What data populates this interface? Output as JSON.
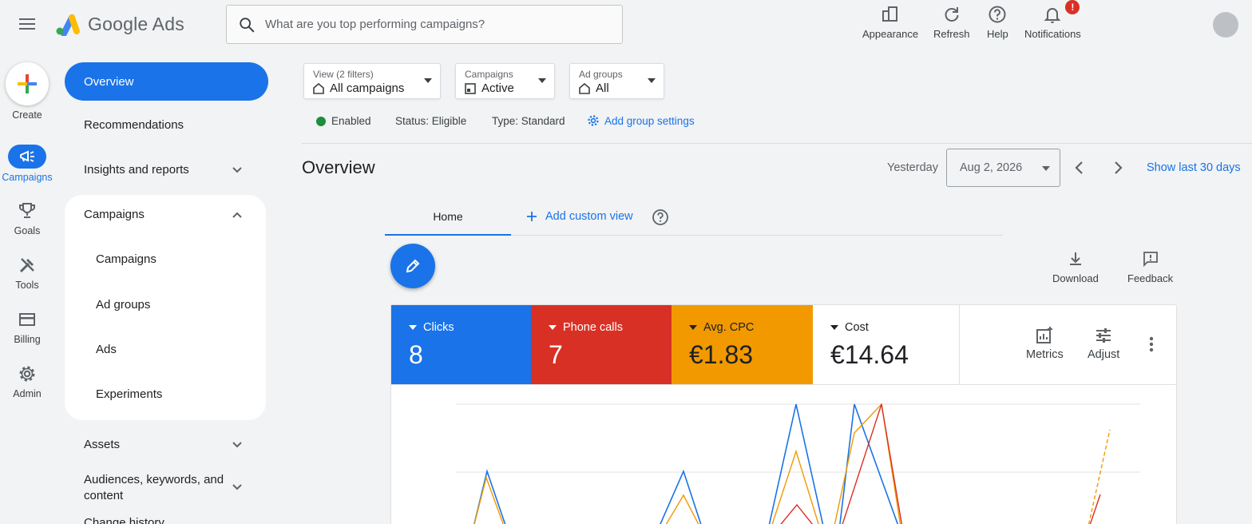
{
  "app": {
    "name": "Google Ads"
  },
  "search": {
    "placeholder": "What are you top performing campaigns?"
  },
  "top_actions": [
    {
      "label": "Appearance",
      "icon": "appearance-icon"
    },
    {
      "label": "Refresh",
      "icon": "refresh-icon"
    },
    {
      "label": "Help",
      "icon": "help-icon"
    },
    {
      "label": "Notifications",
      "icon": "notifications-icon",
      "badge": "!"
    }
  ],
  "rail": [
    {
      "label": "Create",
      "icon": "plus-icon"
    },
    {
      "label": "Campaigns",
      "icon": "campaigns-icon",
      "active": true
    },
    {
      "label": "Goals",
      "icon": "trophy-icon"
    },
    {
      "label": "Tools",
      "icon": "tools-icon"
    },
    {
      "label": "Billing",
      "icon": "card-icon"
    },
    {
      "label": "Admin",
      "icon": "gear-icon"
    }
  ],
  "nav": {
    "overview": "Overview",
    "recommendations": "Recommendations",
    "insights": "Insights and reports",
    "campaigns_group": "Campaigns",
    "sub": [
      "Campaigns",
      "Ad groups",
      "Ads",
      "Experiments"
    ],
    "assets": "Assets",
    "audiences": "Audiences, keywords, and content",
    "change_history": "Change history"
  },
  "filters": [
    {
      "label": "View (2 filters)",
      "value": "All campaigns"
    },
    {
      "label": "Campaigns",
      "value": "Active"
    },
    {
      "label": "Ad groups",
      "value": "All"
    }
  ],
  "status": {
    "enabled": "Enabled",
    "status": "Status: Eligible",
    "type": "Type: Standard",
    "settings_link": "Add group settings"
  },
  "overview": {
    "title": "Overview",
    "yesterday": "Yesterday",
    "date": "Aug 2, 2026",
    "show_last": "Show last 30 days"
  },
  "tabs": {
    "home": "Home",
    "add_custom": "Add custom view"
  },
  "actions": {
    "download": "Download",
    "feedback": "Feedback"
  },
  "metrics": [
    {
      "name": "Clicks",
      "value": "8",
      "bg": "#1a73e8",
      "fg": "#ffffff"
    },
    {
      "name": "Phone calls",
      "value": "7",
      "bg": "#d93025",
      "fg": "#ffffff"
    },
    {
      "name": "Avg. CPC",
      "value": "€1.83",
      "bg": "#f29900",
      "fg": "#202124"
    },
    {
      "name": "Cost",
      "value": "€14.64",
      "bg": "#ffffff",
      "fg": "#202124"
    }
  ],
  "metric_actions": {
    "metrics": "Metrics",
    "adjust": "Adjust"
  },
  "colors": {
    "accent": "#1a73e8",
    "red": "#d93025",
    "orange": "#f29900",
    "green": "#1e8e3e"
  }
}
